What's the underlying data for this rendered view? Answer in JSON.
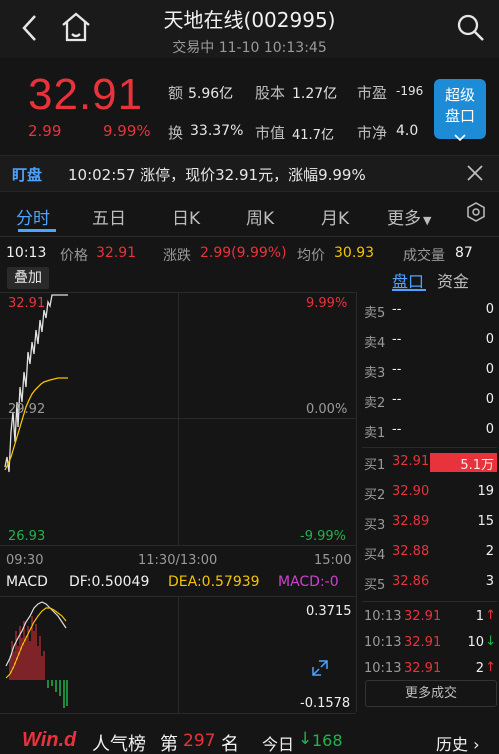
{
  "header": {
    "title": "天地在线(002995)",
    "subtitle": "交易中 11-10 10:13:45"
  },
  "quote": {
    "price": "32.91",
    "change": "2.99",
    "change_pct": "9.99%",
    "amount_label": "额",
    "amount": "5.96亿",
    "capital_label": "股本",
    "capital": "1.27亿",
    "pe_label": "市盈",
    "pe": "-196",
    "turnover_label": "换",
    "turnover": "33.37%",
    "mktcap_label": "市值",
    "mktcap": "41.7亿",
    "pb_label": "市净",
    "pb": "4.0",
    "super_btn": "超级\n盘口"
  },
  "alert": {
    "tag": "盯盘",
    "text": "10:02:57 涨停，现价32.91元，涨幅9.99%"
  },
  "tabs": [
    "分时",
    "五日",
    "日K",
    "周K",
    "月K",
    "更多"
  ],
  "info": {
    "time": "10:13",
    "price_label": "价格",
    "price": "32.91",
    "change_label": "涨跌",
    "change": "2.99(9.99%)",
    "avg_label": "均价",
    "avg": "30.93",
    "vol_label": "成交量",
    "vol": "87"
  },
  "overlay_label": "叠加",
  "book_tabs": [
    "盘口",
    "资金"
  ],
  "chart": {
    "y_top_left": "32.91",
    "y_mid_left": "29.92",
    "y_bottom_left": "26.93",
    "y_top_right": "9.99%",
    "y_mid_right": "0.00%",
    "y_bottom_right": "-9.99%",
    "x_start": "09:30",
    "x_mid": "11:30/13:00",
    "x_end": "15:00",
    "price_color": "#e0e0e0",
    "avg_color": "#f5c400"
  },
  "macd": {
    "label": "MACD",
    "df": "DF:0.50049",
    "dea": "DEA:0.57939",
    "macd": "MACD:-0",
    "top": "0.3715",
    "bottom": "-0.1578"
  },
  "asks": [
    {
      "label": "卖5",
      "price": "--",
      "vol": "0"
    },
    {
      "label": "卖4",
      "price": "--",
      "vol": "0"
    },
    {
      "label": "卖3",
      "price": "--",
      "vol": "0"
    },
    {
      "label": "卖2",
      "price": "--",
      "vol": "0"
    },
    {
      "label": "卖1",
      "price": "--",
      "vol": "0"
    }
  ],
  "bids": [
    {
      "label": "买1",
      "price": "32.91",
      "vol": "5.1万"
    },
    {
      "label": "买2",
      "price": "32.90",
      "vol": "19"
    },
    {
      "label": "买3",
      "price": "32.89",
      "vol": "15"
    },
    {
      "label": "买4",
      "price": "32.88",
      "vol": "2"
    },
    {
      "label": "买5",
      "price": "32.86",
      "vol": "3"
    }
  ],
  "trades": [
    {
      "time": "10:13",
      "price": "32.91",
      "vol": "1",
      "dir": "up"
    },
    {
      "time": "10:13",
      "price": "32.91",
      "vol": "10",
      "dir": "down"
    },
    {
      "time": "10:13",
      "price": "32.91",
      "vol": "2",
      "dir": "up"
    }
  ],
  "more_trades": "更多成交",
  "footer": {
    "brand": "Win.d",
    "rank_label": "人气榜",
    "rank_pre": "第",
    "rank": "297",
    "rank_post": "名",
    "today": "今日",
    "today_val": "168",
    "history": "历史"
  }
}
